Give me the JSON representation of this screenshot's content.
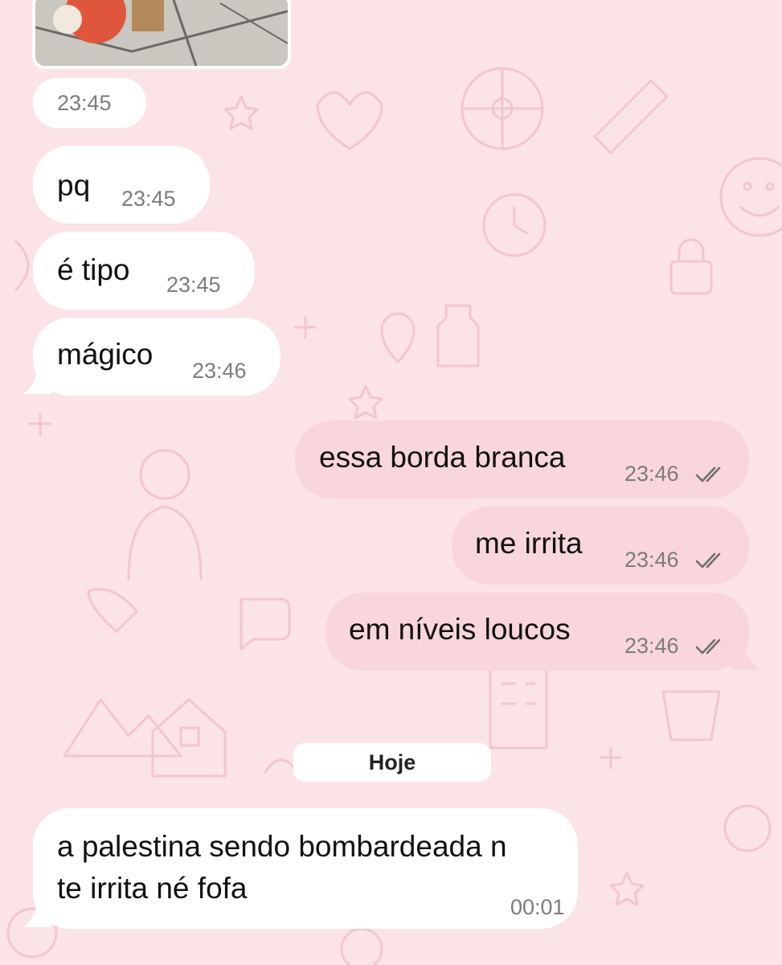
{
  "chat": {
    "previous_media": {
      "time": "23:45"
    },
    "messages": [
      {
        "direction": "incoming",
        "text": "pq",
        "time": "23:45"
      },
      {
        "direction": "incoming",
        "text": "é tipo",
        "time": "23:45"
      },
      {
        "direction": "incoming",
        "text": "mágico",
        "time": "23:46"
      },
      {
        "direction": "outgoing",
        "text": "essa borda branca",
        "time": "23:46",
        "status": "read"
      },
      {
        "direction": "outgoing",
        "text": "me irrita",
        "time": "23:46",
        "status": "read"
      },
      {
        "direction": "outgoing",
        "text": "em níveis loucos",
        "time": "23:46",
        "status": "read"
      }
    ],
    "date_separator": "Hoje",
    "last_message": {
      "direction": "incoming",
      "line1": "a palestina sendo bombardeada n",
      "line2": "te irrita né fofa",
      "time": "00:01"
    }
  },
  "theme": {
    "wallpaper": "#fbe3e8",
    "doodle": "#f3c6cf",
    "incoming_bubble": "#ffffff",
    "outgoing_bubble": "#f8d6dc",
    "time_text": "#7c7c7c",
    "tick": "#6f6f6f"
  }
}
